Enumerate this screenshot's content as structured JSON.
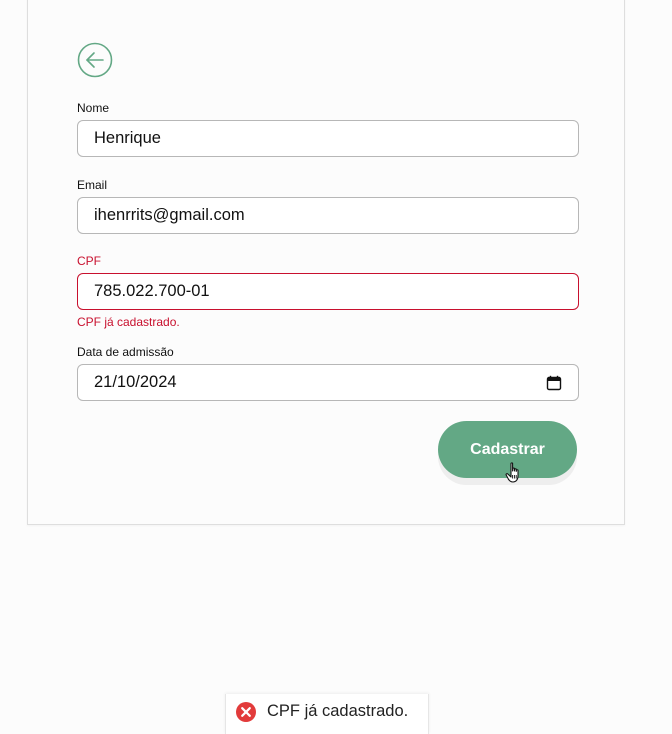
{
  "form": {
    "back_button": {
      "icon": "arrow-left-circle-icon",
      "color": "#63a885"
    },
    "fields": {
      "nome": {
        "label": "Nome",
        "value": "Henrique"
      },
      "email": {
        "label": "Email",
        "value": "ihenrrits@gmail.com"
      },
      "cpf": {
        "label": "CPF",
        "value": "785.022.700-01",
        "error": "CPF já cadastrado."
      },
      "data_admissao": {
        "label": "Data de admissão",
        "value": "21/10/2024",
        "icon": "calendar-icon"
      }
    },
    "submit_label": "Cadastrar"
  },
  "toast": {
    "icon": "error-x-icon",
    "message": "CPF já cadastrado."
  },
  "colors": {
    "accent": "#63a885",
    "error": "#c8102e",
    "border": "#b7b7b7"
  }
}
